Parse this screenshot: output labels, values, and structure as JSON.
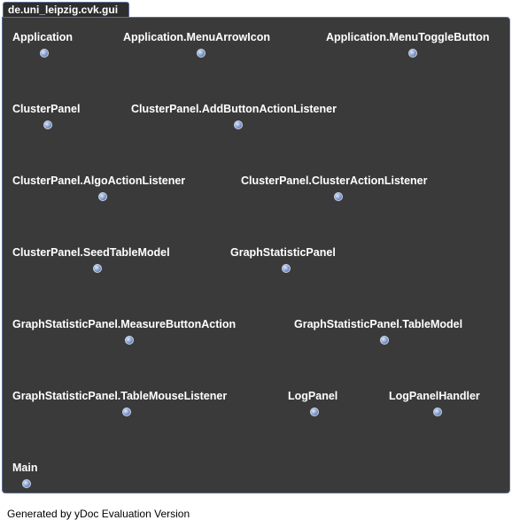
{
  "package": {
    "name": "de.uni_leipzig.cvk.gui"
  },
  "classes": [
    {
      "label": "Application"
    },
    {
      "label": "Application.MenuArrowIcon"
    },
    {
      "label": "Application.MenuToggleButton"
    },
    {
      "label": "ClusterPanel"
    },
    {
      "label": "ClusterPanel.AddButtonActionListener"
    },
    {
      "label": "ClusterPanel.AlgoActionListener"
    },
    {
      "label": "ClusterPanel.ClusterActionListener"
    },
    {
      "label": "ClusterPanel.SeedTableModel"
    },
    {
      "label": "GraphStatisticPanel"
    },
    {
      "label": "GraphStatisticPanel.MeasureButtonAction"
    },
    {
      "label": "GraphStatisticPanel.TableModel"
    },
    {
      "label": "GraphStatisticPanel.TableMouseListener"
    },
    {
      "label": "LogPanel"
    },
    {
      "label": "LogPanelHandler"
    },
    {
      "label": "Main"
    }
  ],
  "footer": {
    "text": "Generated by yDoc Evaluation Version"
  },
  "colors": {
    "panel": "#3a3a3a",
    "border": "#5a6f9a",
    "text": "#ffffff",
    "icon": "#8ea6d4"
  }
}
